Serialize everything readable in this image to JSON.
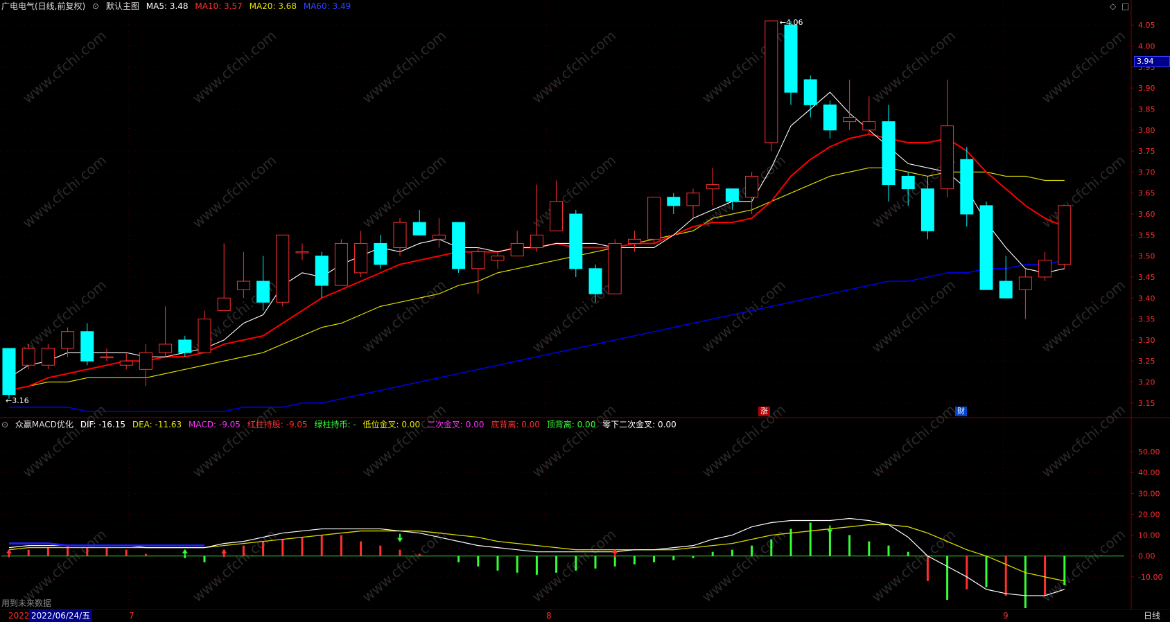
{
  "header": {
    "stock_name": "广电电气(日线,前复权)",
    "main_chart_label": "默认主图",
    "ma5": "MA5: 3.48",
    "ma10": "MA10: 3.57",
    "ma20": "MA20: 3.68",
    "ma60": "MA60: 3.49"
  },
  "indicator": {
    "name": "众赢MACD优化",
    "dif": "DIF: -16.15",
    "dea": "DEA: -11.63",
    "macd": "MACD: -9.05",
    "red_hold": "红柱持股: -9.05",
    "green_hold": "绿柱持币: -",
    "low_cross": "低位金叉: 0.00",
    "second_cross": "二次金叉: 0.00",
    "bottom_div": "底背离: 0.00",
    "top_div": "顶背离: 0.00",
    "zero_second": "零下二次金叉: 0.00"
  },
  "price_axis": {
    "ticks": [
      "4.05",
      "4.00",
      "3.95",
      "3.90",
      "3.85",
      "3.80",
      "3.75",
      "3.70",
      "3.65",
      "3.60",
      "3.55",
      "3.50",
      "3.45",
      "3.40",
      "3.35",
      "3.30",
      "3.25",
      "3.20",
      "3.15"
    ],
    "current_price": "3.94"
  },
  "macd_axis": {
    "ticks": [
      "50.00",
      "40.00",
      "30.00",
      "20.00",
      "10.00",
      "0.00",
      "-10.00"
    ]
  },
  "annotations": {
    "high_label": "4.06",
    "low_label": "3.16",
    "event_zhang": "涨",
    "event_cai": "财"
  },
  "bottom_bar": {
    "future_data": "用到未来数据",
    "year": "2022",
    "date": "2022/06/24/五",
    "month7": "7",
    "month8": "8",
    "month9": "9",
    "period": "日线"
  },
  "watermark": "www.cfchi.com",
  "colors": {
    "up": "#ff3232",
    "down": "#00ffff",
    "ma5": "#ffffff",
    "ma10": "#ff0000",
    "ma20": "#dcdc00",
    "ma60": "#0000ff",
    "grid": "#800000"
  },
  "chart_data": {
    "type": "candlestick",
    "price_range": [
      3.12,
      4.08
    ],
    "macd_range": [
      -25,
      60
    ],
    "candles": [
      [
        3.28,
        3.17,
        3.28,
        3.16
      ],
      [
        3.24,
        3.28,
        3.29,
        3.23
      ],
      [
        3.24,
        3.28,
        3.29,
        3.23
      ],
      [
        3.28,
        3.32,
        3.33,
        3.26
      ],
      [
        3.32,
        3.25,
        3.34,
        3.24
      ],
      [
        3.26,
        3.26,
        3.28,
        3.25
      ],
      [
        3.24,
        3.25,
        3.27,
        3.23
      ],
      [
        3.23,
        3.27,
        3.29,
        3.19
      ],
      [
        3.27,
        3.29,
        3.38,
        3.26
      ],
      [
        3.3,
        3.27,
        3.31,
        3.26
      ],
      [
        3.27,
        3.35,
        3.37,
        3.27
      ],
      [
        3.37,
        3.4,
        3.53,
        3.37
      ],
      [
        3.42,
        3.44,
        3.51,
        3.4
      ],
      [
        3.44,
        3.39,
        3.5,
        3.37
      ],
      [
        3.39,
        3.55,
        3.55,
        3.38
      ],
      [
        3.51,
        3.51,
        3.53,
        3.49
      ],
      [
        3.5,
        3.43,
        3.51,
        3.4
      ],
      [
        3.43,
        3.53,
        3.54,
        3.43
      ],
      [
        3.46,
        3.53,
        3.56,
        3.45
      ],
      [
        3.53,
        3.48,
        3.55,
        3.47
      ],
      [
        3.52,
        3.58,
        3.59,
        3.5
      ],
      [
        3.58,
        3.55,
        3.61,
        3.55
      ],
      [
        3.54,
        3.55,
        3.59,
        3.52
      ],
      [
        3.58,
        3.47,
        3.58,
        3.46
      ],
      [
        3.47,
        3.51,
        3.52,
        3.41
      ],
      [
        3.49,
        3.5,
        3.51,
        3.47
      ],
      [
        3.5,
        3.53,
        3.56,
        3.5
      ],
      [
        3.52,
        3.55,
        3.67,
        3.51
      ],
      [
        3.56,
        3.63,
        3.68,
        3.56
      ],
      [
        3.6,
        3.47,
        3.61,
        3.45
      ],
      [
        3.47,
        3.41,
        3.48,
        3.39
      ],
      [
        3.41,
        3.53,
        3.54,
        3.41
      ],
      [
        3.53,
        3.54,
        3.56,
        3.51
      ],
      [
        3.54,
        3.64,
        3.64,
        3.53
      ],
      [
        3.64,
        3.62,
        3.65,
        3.6
      ],
      [
        3.62,
        3.65,
        3.66,
        3.59
      ],
      [
        3.66,
        3.67,
        3.71,
        3.62
      ],
      [
        3.66,
        3.63,
        3.66,
        3.61
      ],
      [
        3.64,
        3.69,
        3.7,
        3.6
      ],
      [
        3.77,
        4.06,
        4.06,
        3.75
      ],
      [
        4.05,
        3.89,
        4.06,
        3.86
      ],
      [
        3.92,
        3.86,
        3.93,
        3.83
      ],
      [
        3.86,
        3.8,
        3.87,
        3.78
      ],
      [
        3.82,
        3.83,
        3.92,
        3.8
      ],
      [
        3.8,
        3.82,
        3.88,
        3.79
      ],
      [
        3.82,
        3.67,
        3.86,
        3.63
      ],
      [
        3.69,
        3.66,
        3.7,
        3.62
      ],
      [
        3.66,
        3.56,
        3.69,
        3.54
      ],
      [
        3.66,
        3.81,
        3.92,
        3.64
      ],
      [
        3.73,
        3.6,
        3.76,
        3.57
      ],
      [
        3.62,
        3.42,
        3.63,
        3.42
      ],
      [
        3.44,
        3.4,
        3.5,
        3.4
      ],
      [
        3.42,
        3.45,
        3.47,
        3.35
      ],
      [
        3.45,
        3.49,
        3.51,
        3.44
      ],
      [
        3.48,
        3.62,
        3.62,
        3.47
      ]
    ],
    "ma5": [
      3.21,
      3.24,
      3.25,
      3.27,
      3.27,
      3.27,
      3.27,
      3.26,
      3.26,
      3.27,
      3.28,
      3.3,
      3.34,
      3.36,
      3.43,
      3.46,
      3.45,
      3.48,
      3.5,
      3.52,
      3.51,
      3.53,
      3.54,
      3.52,
      3.52,
      3.51,
      3.52,
      3.52,
      3.53,
      3.53,
      3.53,
      3.52,
      3.52,
      3.52,
      3.55,
      3.59,
      3.61,
      3.63,
      3.63,
      3.71,
      3.81,
      3.85,
      3.89,
      3.84,
      3.8,
      3.76,
      3.72,
      3.71,
      3.7,
      3.66,
      3.58,
      3.52,
      3.47,
      3.46,
      3.47
    ],
    "ma10": [
      3.18,
      3.19,
      3.21,
      3.22,
      3.23,
      3.24,
      3.25,
      3.25,
      3.26,
      3.26,
      3.27,
      3.29,
      3.3,
      3.31,
      3.34,
      3.37,
      3.4,
      3.42,
      3.44,
      3.46,
      3.48,
      3.49,
      3.5,
      3.51,
      3.51,
      3.51,
      3.52,
      3.52,
      3.53,
      3.52,
      3.52,
      3.52,
      3.53,
      3.53,
      3.55,
      3.57,
      3.58,
      3.58,
      3.59,
      3.63,
      3.69,
      3.73,
      3.76,
      3.78,
      3.79,
      3.78,
      3.77,
      3.77,
      3.78,
      3.75,
      3.7,
      3.66,
      3.62,
      3.59,
      3.57
    ],
    "ma20": [
      3.18,
      3.19,
      3.2,
      3.2,
      3.21,
      3.21,
      3.21,
      3.21,
      3.22,
      3.23,
      3.24,
      3.25,
      3.26,
      3.27,
      3.29,
      3.31,
      3.33,
      3.34,
      3.36,
      3.38,
      3.39,
      3.4,
      3.41,
      3.43,
      3.44,
      3.46,
      3.47,
      3.48,
      3.49,
      3.5,
      3.51,
      3.52,
      3.53,
      3.54,
      3.55,
      3.56,
      3.59,
      3.6,
      3.61,
      3.63,
      3.65,
      3.67,
      3.69,
      3.7,
      3.71,
      3.71,
      3.7,
      3.69,
      3.7,
      3.7,
      3.7,
      3.69,
      3.69,
      3.68,
      3.68
    ],
    "ma60": [
      3.14,
      3.14,
      3.14,
      3.14,
      3.13,
      3.13,
      3.13,
      3.13,
      3.13,
      3.13,
      3.13,
      3.13,
      3.14,
      3.14,
      3.14,
      3.15,
      3.15,
      3.16,
      3.17,
      3.18,
      3.19,
      3.2,
      3.21,
      3.22,
      3.23,
      3.24,
      3.25,
      3.26,
      3.27,
      3.28,
      3.29,
      3.3,
      3.31,
      3.32,
      3.33,
      3.34,
      3.35,
      3.36,
      3.37,
      3.38,
      3.39,
      3.4,
      3.41,
      3.42,
      3.43,
      3.44,
      3.44,
      3.45,
      3.46,
      3.46,
      3.47,
      3.47,
      3.48,
      3.48,
      3.49
    ],
    "macd_hist": [
      2,
      3,
      4,
      5,
      4,
      4,
      3,
      1,
      0,
      -1,
      -3,
      3,
      5,
      7,
      8,
      9,
      10,
      10,
      7,
      5,
      3,
      1,
      0,
      -3,
      -5,
      -7,
      -8,
      -9,
      -8,
      -7,
      -6,
      -5,
      -4,
      -3,
      -2,
      -1,
      2,
      3,
      5,
      8,
      13,
      16,
      12,
      10,
      7,
      5,
      2,
      -12,
      -21,
      -16,
      -15,
      -19,
      -25,
      -19,
      -14
    ],
    "dif": [
      4,
      5,
      5,
      5,
      5,
      5,
      5,
      4,
      4,
      4,
      4,
      6,
      7,
      9,
      11,
      12,
      13,
      13,
      13,
      13,
      12,
      11,
      9,
      7,
      5,
      4,
      3,
      2,
      2,
      2,
      2,
      2,
      3,
      3,
      4,
      5,
      8,
      10,
      14,
      16,
      17,
      17,
      17,
      18,
      17,
      15,
      9,
      0,
      -5,
      -10,
      -16,
      -18,
      -19,
      -19,
      -16
    ],
    "dea": [
      3,
      4,
      4,
      4,
      4,
      4,
      4,
      4,
      4,
      4,
      4,
      5,
      6,
      7,
      8,
      9,
      10,
      11,
      12,
      12,
      12,
      12,
      11,
      10,
      9,
      7,
      6,
      5,
      4,
      3,
      3,
      3,
      3,
      3,
      3,
      4,
      5,
      6,
      8,
      10,
      11,
      12,
      13,
      14,
      15,
      15,
      14,
      11,
      7,
      3,
      0,
      -4,
      -8,
      -10,
      -12
    ],
    "blue_line": [
      6,
      6,
      6,
      5,
      5,
      5,
      5,
      5,
      5,
      5,
      5
    ]
  }
}
